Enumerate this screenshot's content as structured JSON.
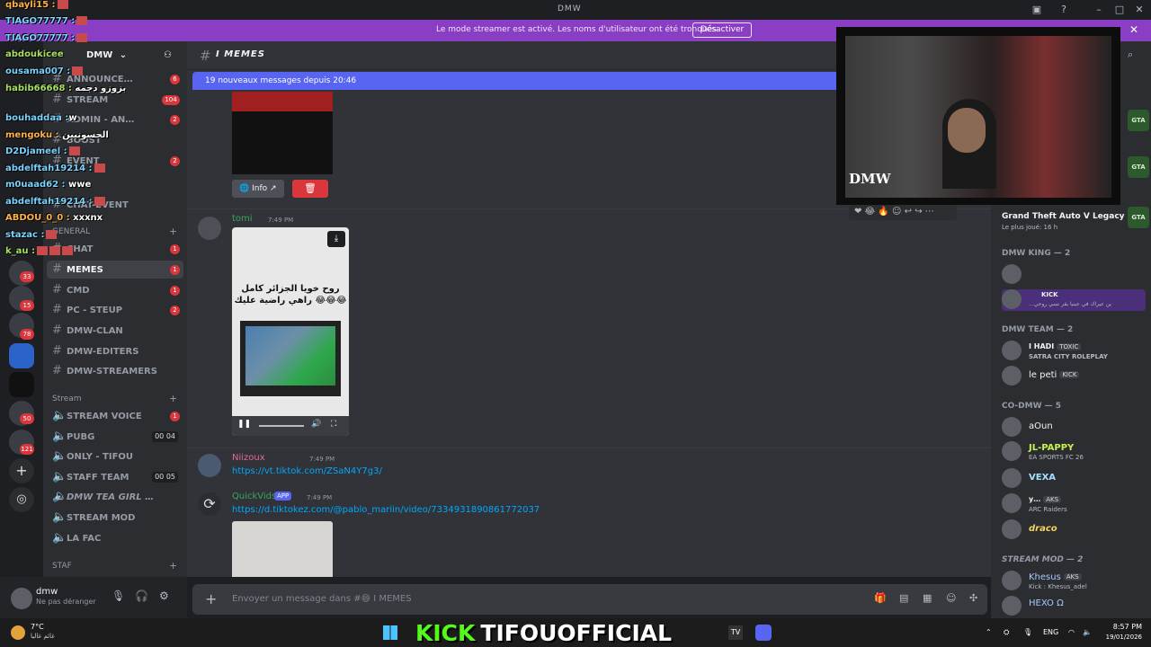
{
  "window": {
    "title": "DMW"
  },
  "banner": {
    "message": "Le mode streamer est activé. Les noms d'utilisateur ont été tronqués.",
    "button": "Désactiver",
    "close": "✕"
  },
  "overlay_chat": [
    {
      "name": "qbayli15 :",
      "text": ""
    },
    {
      "name": "TIAGO77777 :",
      "text": ""
    },
    {
      "name": "TIAGO77777 :",
      "text": ""
    },
    {
      "name": "abdoukicee",
      "text": ""
    },
    {
      "name": "ousama007 :",
      "text": ""
    },
    {
      "name": "habib66668 :",
      "text": "بزوزو دجمه"
    },
    {
      "name": "bouhaddaa :",
      "text": "w"
    },
    {
      "name": "mengoku :",
      "text": "الحسونيين"
    },
    {
      "name": "D2Djameel :",
      "text": ""
    },
    {
      "name": "abdelftah19214 :",
      "text": ""
    },
    {
      "name": "m0uaad62 :",
      "text": "wwe"
    },
    {
      "name": "abdelftah19214 :",
      "text": ""
    },
    {
      "name": "ABDOU_0_0 :",
      "text": "xxxnx"
    },
    {
      "name": "stazac :",
      "text": ""
    },
    {
      "name": "k_au :",
      "text": ""
    }
  ],
  "rail": {
    "badges": [
      "33",
      "15",
      "78",
      "50",
      "121"
    ]
  },
  "sidebar": {
    "server_name": "DMW",
    "channels": [
      {
        "name": "ANNOUNCE…",
        "badge": "6"
      },
      {
        "name": "STREAM",
        "badge": "104"
      },
      {
        "name": "ADMIN - AN…",
        "badge": "2"
      },
      {
        "name": "BOOST",
        "badge": ""
      },
      {
        "name": "EVENT",
        "badge": "2"
      },
      {
        "name": "CHAT-EVENT",
        "badge": ""
      },
      {
        "name": "CHAT",
        "badge": "1"
      },
      {
        "name": "MEMES",
        "badge": "1"
      },
      {
        "name": "CMD",
        "badge": "1"
      },
      {
        "name": "PC - STEUP",
        "badge": "2"
      },
      {
        "name": "DMW-CLAN",
        "badge": ""
      },
      {
        "name": "DMW-EDITERS",
        "badge": ""
      },
      {
        "name": "DMW-STREAMERS",
        "badge": ""
      }
    ],
    "categories": {
      "general": "GENERAL",
      "stream": "Stream",
      "staf": "STAF"
    },
    "voice_channels": [
      {
        "name": "STREAM VOICE",
        "count": "1"
      },
      {
        "name": "PUBG",
        "count": "00 04"
      },
      {
        "name": "ONLY - TIFOU",
        "count": ""
      },
      {
        "name": "STAFF TEAM",
        "count": "00 05"
      },
      {
        "name": "DMW TEA GIRL …",
        "count": ""
      },
      {
        "name": "STREAM MOD",
        "count": ""
      },
      {
        "name": "LA FAC",
        "count": ""
      }
    ]
  },
  "user": {
    "name": "dmw",
    "status": "Ne pas déranger"
  },
  "main": {
    "channel_name": "I MEMES",
    "new_messages": "19 nouveaux messages depuis 20:46",
    "info_label": "Info",
    "messages": [
      {
        "author": "tomi",
        "time": "7:49 PM",
        "video_caption": "روح خويا الجزائر كامل راهي راضية عليك 😂😂😂"
      },
      {
        "author": "Niizoux",
        "time": "7:49 PM",
        "link": "https://vt.tiktok.com/ZSaN4Y7g3/"
      },
      {
        "author": "QuickVids",
        "badge": "APP",
        "time": "7:49 PM",
        "link": "https://d.tiktokez.com/@pablo_mariin/video/7334931890861772037"
      }
    ],
    "input_placeholder": "Envoyer un message dans #😄 I MEMES"
  },
  "members": {
    "now_playing": {
      "game": "Grand Theft Auto V Legacy",
      "sub": "Le plus joué: 16 h"
    },
    "groups": [
      {
        "label": "DMW KING — 2",
        "members": [
          {
            "name": "",
            "activity": ""
          },
          {
            "name": "KICK",
            "activity": "...ين عيراك في عينيا بقر نسي روحي"
          }
        ]
      },
      {
        "label": "DMW TEAM — 2",
        "members": [
          {
            "name": "I HADI",
            "tag": "TOXIC",
            "activity": "SATRA CITY ROLEPLAY"
          },
          {
            "name": "le peti",
            "tag": "KICK",
            "activity": ""
          }
        ]
      },
      {
        "label": "CO-DMW — 5",
        "members": [
          {
            "name": "aOun",
            "activity": ""
          },
          {
            "name": "JL-PAPPY",
            "activity": "EA SPORTS FC 26"
          },
          {
            "name": "VEXA",
            "activity": ""
          },
          {
            "name": "y…",
            "tag": "AKS",
            "activity": "ARC Raiders"
          },
          {
            "name": "draco",
            "activity": ""
          }
        ]
      },
      {
        "label": "STREAM MOD — 2",
        "members": [
          {
            "name": "Khesus",
            "tag": "AKS",
            "activity": "Kick : Khesus_adel"
          },
          {
            "name": "HEXO Ω",
            "activity": ""
          }
        ]
      }
    ]
  },
  "webcam": {
    "logo": "DMW"
  },
  "taskbar": {
    "weather_temp": "7°C",
    "weather_desc": "غائم غالبا",
    "kick_brand": "KICK",
    "channel": "TIFOUOFFICIAL",
    "lang": "ENG",
    "time": "8:57 PM",
    "date": "19/01/2026"
  }
}
